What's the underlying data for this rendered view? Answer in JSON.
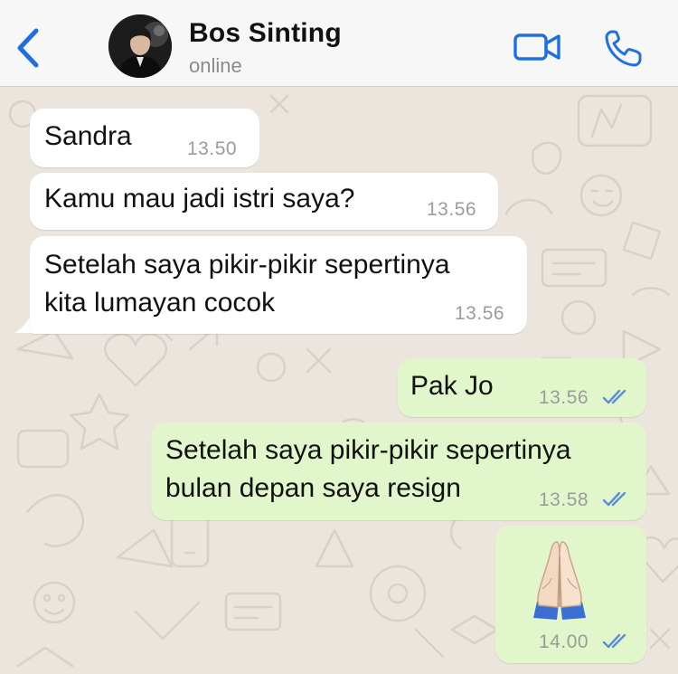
{
  "header": {
    "contact_name": "Bos Sinting",
    "status": "online",
    "back_icon": "chevron-left-icon",
    "video_icon": "video-camera-icon",
    "call_icon": "phone-icon"
  },
  "colors": {
    "accent": "#1f6fe0",
    "incoming_bubble": "#ffffff",
    "outgoing_bubble": "#e1f7cb",
    "read_ticks": "#5b8fd9",
    "chat_background": "#ece5dd"
  },
  "messages": [
    {
      "direction": "incoming",
      "text": "Sandra",
      "time": "13.50"
    },
    {
      "direction": "incoming",
      "text": "Kamu mau jadi istri saya?",
      "time": "13.56"
    },
    {
      "direction": "incoming",
      "text": "Setelah saya pikir-pikir sepertinya\nkita lumayan cocok",
      "time": "13.56"
    },
    {
      "direction": "outgoing",
      "text": "Pak Jo",
      "time": "13.56",
      "status": "read"
    },
    {
      "direction": "outgoing",
      "text": "Setelah saya pikir-pikir sepertinya\nbulan depan saya resign",
      "time": "13.58",
      "status": "read"
    },
    {
      "direction": "outgoing",
      "text": "",
      "emoji": "folded-hands-emoji",
      "time": "14.00",
      "status": "read"
    }
  ]
}
